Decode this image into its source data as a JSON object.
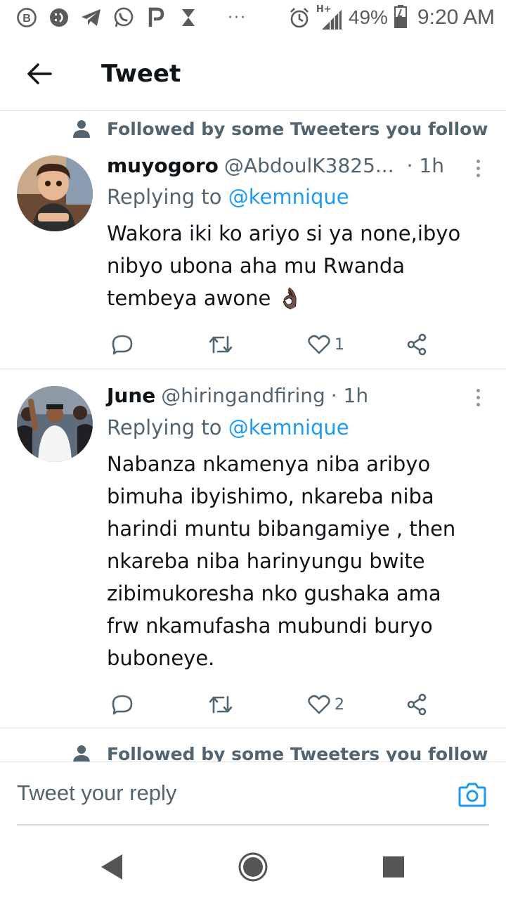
{
  "status_bar": {
    "battery": "49%",
    "time": "9:20 AM",
    "network": "H+",
    "more_indicator": "···",
    "notification_icons": [
      "b-icon",
      "emoji-icon",
      "telegram-icon",
      "whatsapp-icon",
      "p-icon",
      "hourglass-icon"
    ]
  },
  "header": {
    "title": "Tweet"
  },
  "tweets": [
    {
      "social_context": "Followed by some Tweeters you follow",
      "name": "muyogoro",
      "handle": "@AbdoulK3825...",
      "time": "· 1h",
      "replying_prefix": "Replying to ",
      "replying_to": "@kemnique",
      "text": "Wakora iki ko ariyo si ya none,ibyo nibyo ubona aha mu Rwanda tembeya awone 👌🏿",
      "likes": "1"
    },
    {
      "name": "June",
      "handle": "@hiringandfiring",
      "time": "· 1h",
      "replying_prefix": "Replying to ",
      "replying_to": "@kemnique",
      "text": "Nabanza nkamenya niba aribyo bimuha ibyishimo, nkareba niba harindi muntu bibangamiye , then nkareba niba harinyungu bwite zibimukoresha nko gushaka ama frw nkamufasha mubundi buryo buboneye.",
      "likes": "2"
    }
  ],
  "next_social_context": "Followed by some Tweeters you follow",
  "composer": {
    "placeholder": "Tweet your reply"
  },
  "colors": {
    "accent": "#1d9bf0",
    "secondary_text": "#536471",
    "primary_text": "#0f1419"
  }
}
